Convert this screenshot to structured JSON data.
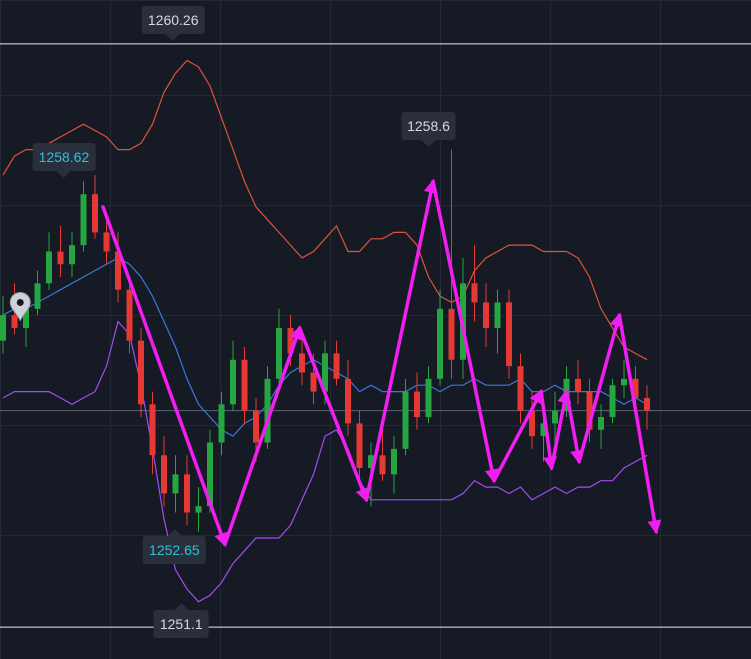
{
  "chart_data": {
    "type": "candlestick",
    "y_range": [
      1250.6,
      1260.95
    ],
    "grid": true,
    "colors": {
      "background": "#161a25",
      "grid": "#232836",
      "up": "#26a641",
      "down": "#e53935",
      "bb_upper": "#e0523a",
      "bb_middle": "#3a78d8",
      "bb_lower": "#a14df0",
      "wave": "#f01ef0",
      "reference_line": "#e8e8e8",
      "price_line": "#5d6475",
      "label_bg": "#2b2f3b",
      "label_text": "#d6d9e0",
      "label_text_highlight": "#26c6da"
    },
    "labels": [
      {
        "text": "1260.26",
        "highlight": false,
        "pointer": "down"
      },
      {
        "text": "1258.62",
        "highlight": true,
        "pointer": "down"
      },
      {
        "text": "1258.6",
        "highlight": false,
        "pointer": "down"
      },
      {
        "text": "1252.65",
        "highlight": true,
        "pointer": "up"
      },
      {
        "text": "1251.1",
        "highlight": false,
        "pointer": "up"
      }
    ],
    "reference_levels": [
      1260.26,
      1251.1
    ],
    "bollinger": {
      "upper": [
        [
          0,
          1258.2
        ],
        [
          1,
          1258.5
        ],
        [
          2,
          1258.6
        ],
        [
          3,
          1258.6
        ],
        [
          4,
          1258.7
        ],
        [
          5,
          1258.8
        ],
        [
          6,
          1258.9
        ],
        [
          7,
          1259.0
        ],
        [
          8,
          1258.9
        ],
        [
          9,
          1258.8
        ],
        [
          10,
          1258.6
        ],
        [
          11,
          1258.6
        ],
        [
          12,
          1258.7
        ],
        [
          13,
          1259.0
        ],
        [
          14,
          1259.5
        ],
        [
          15,
          1259.8
        ],
        [
          16,
          1260.0
        ],
        [
          17,
          1259.9
        ],
        [
          18,
          1259.6
        ],
        [
          19,
          1259.1
        ],
        [
          20,
          1258.6
        ],
        [
          21,
          1258.1
        ],
        [
          22,
          1257.7
        ],
        [
          23,
          1257.5
        ],
        [
          24,
          1257.3
        ],
        [
          25,
          1257.1
        ],
        [
          26,
          1256.9
        ],
        [
          27,
          1257.0
        ],
        [
          28,
          1257.2
        ],
        [
          29,
          1257.4
        ],
        [
          30,
          1257.0
        ],
        [
          31,
          1257.0
        ],
        [
          32,
          1257.2
        ],
        [
          33,
          1257.2
        ],
        [
          34,
          1257.3
        ],
        [
          35,
          1257.3
        ],
        [
          36,
          1257.1
        ],
        [
          37,
          1256.6
        ],
        [
          38,
          1256.3
        ],
        [
          39,
          1256.2
        ],
        [
          40,
          1256.3
        ],
        [
          41,
          1256.7
        ],
        [
          42,
          1256.9
        ],
        [
          43,
          1257.0
        ],
        [
          44,
          1257.1
        ],
        [
          45,
          1257.1
        ],
        [
          46,
          1257.1
        ],
        [
          47,
          1257.0
        ],
        [
          48,
          1257.0
        ],
        [
          49,
          1257.0
        ],
        [
          50,
          1256.9
        ],
        [
          51,
          1256.6
        ],
        [
          52,
          1256.1
        ],
        [
          53,
          1255.8
        ],
        [
          54,
          1255.5
        ],
        [
          55,
          1255.4
        ],
        [
          56,
          1255.3
        ]
      ],
      "middle": [
        [
          0,
          1256.0
        ],
        [
          1,
          1256.1
        ],
        [
          2,
          1256.1
        ],
        [
          3,
          1256.2
        ],
        [
          4,
          1256.3
        ],
        [
          5,
          1256.4
        ],
        [
          6,
          1256.5
        ],
        [
          7,
          1256.6
        ],
        [
          8,
          1256.7
        ],
        [
          9,
          1256.8
        ],
        [
          10,
          1256.9
        ],
        [
          11,
          1256.8
        ],
        [
          12,
          1256.6
        ],
        [
          13,
          1256.3
        ],
        [
          14,
          1255.9
        ],
        [
          15,
          1255.5
        ],
        [
          16,
          1255.0
        ],
        [
          17,
          1254.6
        ],
        [
          18,
          1254.4
        ],
        [
          19,
          1254.2
        ],
        [
          20,
          1254.1
        ],
        [
          21,
          1254.3
        ],
        [
          22,
          1254.4
        ],
        [
          23,
          1254.6
        ],
        [
          24,
          1254.9
        ],
        [
          25,
          1255.1
        ],
        [
          26,
          1255.2
        ],
        [
          27,
          1255.3
        ],
        [
          28,
          1255.2
        ],
        [
          29,
          1255.1
        ],
        [
          30,
          1255.0
        ],
        [
          31,
          1254.8
        ],
        [
          32,
          1254.9
        ],
        [
          33,
          1254.8
        ],
        [
          34,
          1254.8
        ],
        [
          35,
          1254.8
        ],
        [
          36,
          1254.9
        ],
        [
          37,
          1254.9
        ],
        [
          38,
          1254.8
        ],
        [
          39,
          1254.9
        ],
        [
          40,
          1254.9
        ],
        [
          41,
          1255.0
        ],
        [
          42,
          1254.9
        ],
        [
          43,
          1254.9
        ],
        [
          44,
          1254.9
        ],
        [
          45,
          1255.0
        ],
        [
          46,
          1254.8
        ],
        [
          47,
          1254.8
        ],
        [
          48,
          1254.9
        ],
        [
          49,
          1254.8
        ],
        [
          50,
          1254.8
        ],
        [
          51,
          1254.8
        ],
        [
          52,
          1254.8
        ],
        [
          53,
          1254.7
        ],
        [
          54,
          1254.6
        ],
        [
          55,
          1254.7
        ],
        [
          56,
          1254.6
        ]
      ],
      "lower": [
        [
          0,
          1254.7
        ],
        [
          1,
          1254.8
        ],
        [
          2,
          1254.8
        ],
        [
          3,
          1254.8
        ],
        [
          4,
          1254.8
        ],
        [
          5,
          1254.7
        ],
        [
          6,
          1254.6
        ],
        [
          7,
          1254.7
        ],
        [
          8,
          1254.8
        ],
        [
          9,
          1255.2
        ],
        [
          10,
          1255.9
        ],
        [
          11,
          1255.7
        ],
        [
          12,
          1254.9
        ],
        [
          13,
          1253.9
        ],
        [
          14,
          1252.8
        ],
        [
          15,
          1252.0
        ],
        [
          16,
          1251.7
        ],
        [
          17,
          1251.5
        ],
        [
          18,
          1251.6
        ],
        [
          19,
          1251.8
        ],
        [
          20,
          1252.1
        ],
        [
          21,
          1252.3
        ],
        [
          22,
          1252.5
        ],
        [
          23,
          1252.5
        ],
        [
          24,
          1252.5
        ],
        [
          25,
          1252.7
        ],
        [
          26,
          1253.1
        ],
        [
          27,
          1253.5
        ],
        [
          28,
          1254.1
        ],
        [
          29,
          1254.2
        ],
        [
          30,
          1253.9
        ],
        [
          31,
          1253.4
        ],
        [
          32,
          1253.1
        ],
        [
          33,
          1253.1
        ],
        [
          34,
          1253.1
        ],
        [
          35,
          1253.1
        ],
        [
          36,
          1253.1
        ],
        [
          37,
          1253.1
        ],
        [
          38,
          1253.1
        ],
        [
          39,
          1253.1
        ],
        [
          40,
          1253.2
        ],
        [
          41,
          1253.4
        ],
        [
          42,
          1253.3
        ],
        [
          43,
          1253.3
        ],
        [
          44,
          1253.2
        ],
        [
          45,
          1253.3
        ],
        [
          46,
          1253.1
        ],
        [
          47,
          1253.2
        ],
        [
          48,
          1253.3
        ],
        [
          49,
          1253.2
        ],
        [
          50,
          1253.3
        ],
        [
          51,
          1253.3
        ],
        [
          52,
          1253.4
        ],
        [
          53,
          1253.4
        ],
        [
          54,
          1253.6
        ],
        [
          55,
          1253.7
        ],
        [
          56,
          1253.8
        ]
      ]
    },
    "candles": [
      [
        0,
        1255.6,
        1256.3,
        1255.4,
        1256.0
      ],
      [
        1,
        1256.0,
        1256.5,
        1255.7,
        1255.8
      ],
      [
        2,
        1255.8,
        1256.3,
        1255.5,
        1256.1
      ],
      [
        3,
        1256.1,
        1256.7,
        1256.0,
        1256.5
      ],
      [
        4,
        1256.5,
        1257.3,
        1256.4,
        1257.0
      ],
      [
        5,
        1257.0,
        1257.4,
        1256.6,
        1256.8
      ],
      [
        6,
        1256.8,
        1257.3,
        1256.6,
        1257.1
      ],
      [
        7,
        1257.1,
        1258.1,
        1257.0,
        1257.9
      ],
      [
        8,
        1257.9,
        1258.2,
        1257.2,
        1257.3
      ],
      [
        9,
        1257.3,
        1257.5,
        1256.8,
        1257.0
      ],
      [
        10,
        1257.0,
        1257.3,
        1256.2,
        1256.4
      ],
      [
        11,
        1256.4,
        1256.6,
        1255.4,
        1255.6
      ],
      [
        12,
        1255.6,
        1255.8,
        1254.4,
        1254.6
      ],
      [
        13,
        1254.6,
        1254.8,
        1253.5,
        1253.8
      ],
      [
        14,
        1253.8,
        1254.1,
        1253.0,
        1253.2
      ],
      [
        15,
        1253.2,
        1253.8,
        1252.9,
        1253.5
      ],
      [
        16,
        1253.5,
        1253.8,
        1252.7,
        1252.9
      ],
      [
        17,
        1252.9,
        1253.3,
        1252.6,
        1253.0
      ],
      [
        18,
        1253.0,
        1254.2,
        1252.9,
        1254.0
      ],
      [
        19,
        1254.0,
        1254.8,
        1253.8,
        1254.6
      ],
      [
        20,
        1254.6,
        1255.6,
        1254.5,
        1255.3
      ],
      [
        21,
        1255.3,
        1255.5,
        1254.3,
        1254.5
      ],
      [
        22,
        1254.5,
        1254.7,
        1253.7,
        1254.0
      ],
      [
        23,
        1254.0,
        1255.2,
        1253.9,
        1255.0
      ],
      [
        24,
        1255.0,
        1256.1,
        1254.9,
        1255.8
      ],
      [
        25,
        1255.8,
        1256.0,
        1255.2,
        1255.4
      ],
      [
        26,
        1255.4,
        1255.7,
        1254.9,
        1255.1
      ],
      [
        27,
        1255.1,
        1255.4,
        1254.6,
        1254.8
      ],
      [
        28,
        1254.8,
        1255.6,
        1254.6,
        1255.4
      ],
      [
        29,
        1255.4,
        1255.6,
        1254.9,
        1255.0
      ],
      [
        30,
        1255.0,
        1255.3,
        1254.1,
        1254.3
      ],
      [
        31,
        1254.3,
        1254.5,
        1253.4,
        1253.6
      ],
      [
        32,
        1253.6,
        1254.0,
        1253.0,
        1253.8
      ],
      [
        33,
        1253.8,
        1254.4,
        1253.4,
        1253.5
      ],
      [
        34,
        1253.5,
        1254.1,
        1253.2,
        1253.9
      ],
      [
        35,
        1253.9,
        1255.0,
        1253.8,
        1254.8
      ],
      [
        36,
        1254.8,
        1255.1,
        1254.2,
        1254.4
      ],
      [
        37,
        1254.4,
        1255.2,
        1254.3,
        1255.0
      ],
      [
        38,
        1255.0,
        1256.4,
        1254.9,
        1256.1
      ],
      [
        39,
        1256.1,
        1258.6,
        1255.0,
        1255.3
      ],
      [
        40,
        1255.3,
        1256.9,
        1255.0,
        1256.5
      ],
      [
        41,
        1256.5,
        1257.1,
        1255.9,
        1256.2
      ],
      [
        42,
        1256.2,
        1256.5,
        1255.5,
        1255.8
      ],
      [
        43,
        1255.8,
        1256.4,
        1255.4,
        1256.2
      ],
      [
        44,
        1256.2,
        1256.4,
        1255.0,
        1255.2
      ],
      [
        45,
        1255.2,
        1255.4,
        1254.3,
        1254.5
      ],
      [
        46,
        1254.5,
        1254.8,
        1253.9,
        1254.1
      ],
      [
        47,
        1254.1,
        1254.5,
        1253.7,
        1254.3
      ],
      [
        48,
        1254.3,
        1254.8,
        1254.0,
        1254.5
      ],
      [
        49,
        1254.5,
        1255.2,
        1254.4,
        1255.0
      ],
      [
        50,
        1255.0,
        1255.3,
        1254.6,
        1254.8
      ],
      [
        51,
        1254.8,
        1255.0,
        1254.0,
        1254.2
      ],
      [
        52,
        1254.2,
        1254.6,
        1253.9,
        1254.4
      ],
      [
        53,
        1254.4,
        1255.0,
        1254.3,
        1254.9
      ],
      [
        54,
        1254.9,
        1255.3,
        1254.7,
        1255.0
      ],
      [
        55,
        1255.0,
        1255.2,
        1254.5,
        1254.7
      ],
      [
        56,
        1254.7,
        1254.9,
        1254.2,
        1254.5
      ]
    ],
    "wave_path": [
      [
        8.7,
        1257.7
      ],
      [
        19.3,
        1252.4
      ],
      [
        25.8,
        1255.8
      ],
      [
        31.6,
        1253.1
      ],
      [
        37.4,
        1258.1
      ],
      [
        42.7,
        1253.4
      ],
      [
        46.8,
        1254.8
      ],
      [
        47.7,
        1253.6
      ],
      [
        49.0,
        1254.8
      ],
      [
        50.1,
        1253.7
      ],
      [
        53.6,
        1256.0
      ],
      [
        56.8,
        1252.6
      ]
    ],
    "marker": {
      "bar": 1.5,
      "price": 1256.2
    }
  }
}
